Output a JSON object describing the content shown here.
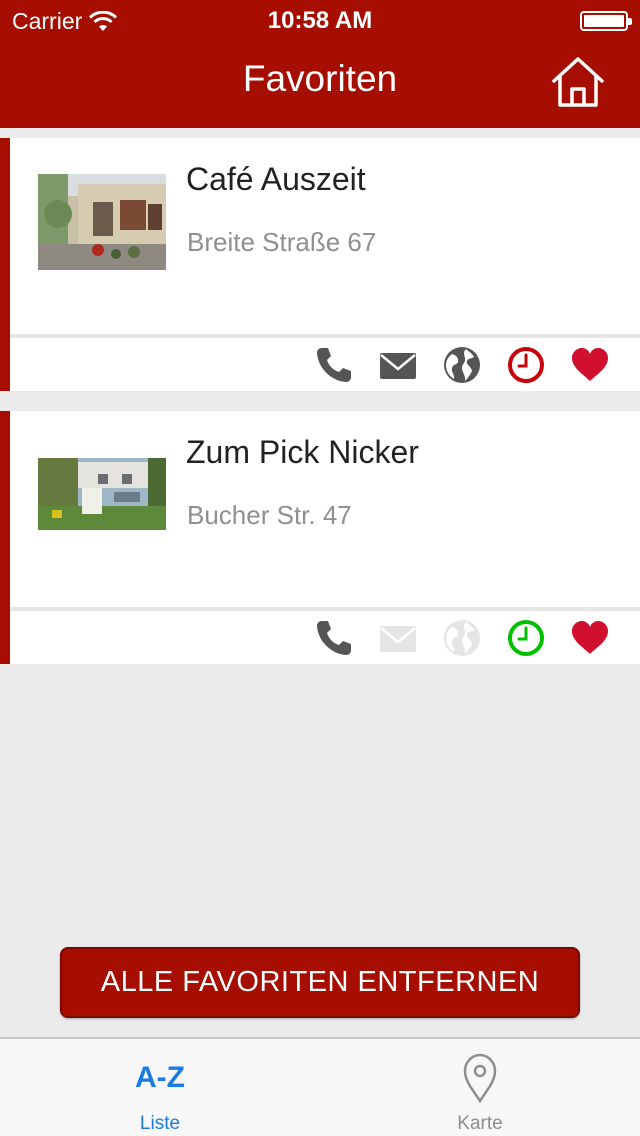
{
  "status_bar": {
    "carrier": "Carrier",
    "time": "10:58 AM"
  },
  "header": {
    "title": "Favoriten",
    "home_icon": "home-icon"
  },
  "favorites": [
    {
      "name": "Café Auszeit",
      "address": "Breite Straße 67",
      "actions": {
        "phone": true,
        "mail": true,
        "web": true,
        "hours_status": "closed",
        "favorite": true
      }
    },
    {
      "name": "Zum Pick Nicker",
      "address": "Bucher Str. 47",
      "actions": {
        "phone": true,
        "mail": false,
        "web": false,
        "hours_status": "open",
        "favorite": true
      }
    }
  ],
  "remove_all_label": "ALLE FAVORITEN ENTFERNEN",
  "tabs": [
    {
      "glyph": "A-Z",
      "label": "Liste",
      "active": true
    },
    {
      "icon": "map-pin-icon",
      "label": "Karte",
      "active": false
    }
  ],
  "colors": {
    "brand_red": "#a50e00",
    "heart_red": "#d0102e",
    "clock_closed": "#c8000a",
    "clock_open": "#00c000",
    "icon_active": "#555555",
    "icon_disabled": "#e5e5e5",
    "tab_active": "#1a7be4"
  }
}
